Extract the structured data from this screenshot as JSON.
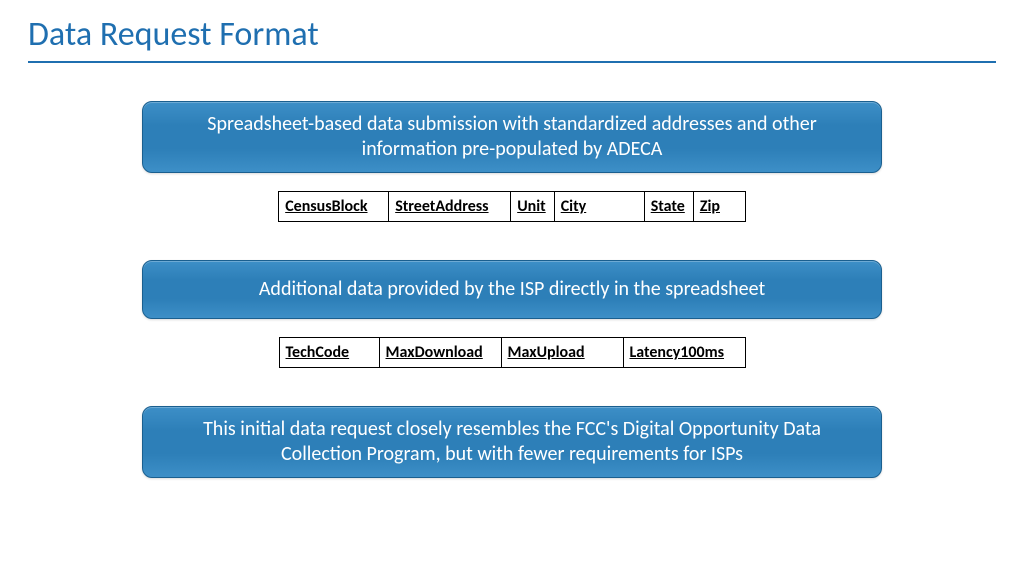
{
  "title": "Data Request Format",
  "pill1": "Spreadsheet-based data submission with standardized addresses and other information pre-populated by ADECA",
  "table1": {
    "cols": [
      "CensusBlock",
      "StreetAddress",
      "Unit",
      "City",
      "State",
      "Zip"
    ]
  },
  "pill2": "Additional data provided by the ISP directly in the spreadsheet",
  "table2": {
    "cols": [
      "TechCode",
      "MaxDownload",
      "MaxUpload",
      "Latency100ms"
    ]
  },
  "pill3": "This initial data request closely resembles the FCC's Digital Opportunity Data Collection Program, but with fewer requirements for ISPs"
}
